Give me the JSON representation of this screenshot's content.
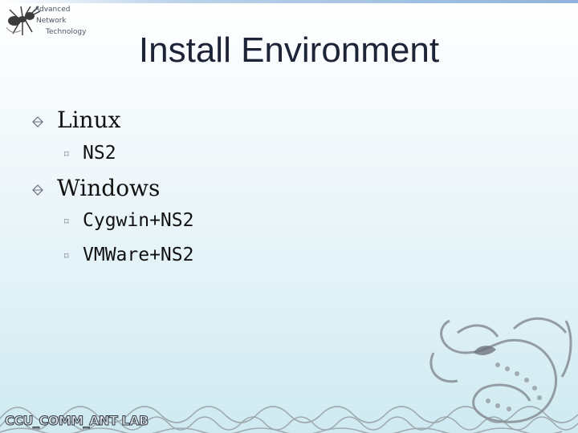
{
  "logo": {
    "lines": [
      "Advanced",
      "Network",
      "Technology"
    ]
  },
  "title": "Install Environment",
  "bullets": [
    {
      "label": "Linux",
      "children": [
        "NS2"
      ]
    },
    {
      "label": "Windows",
      "children": [
        "Cygwin+NS2",
        "VMWare+NS2"
      ]
    }
  ],
  "footer": "CCU_COMM_ANT LAB",
  "colors": {
    "title": "#1d2437",
    "text": "#111111",
    "background_bottom": "#cfeaf1"
  }
}
